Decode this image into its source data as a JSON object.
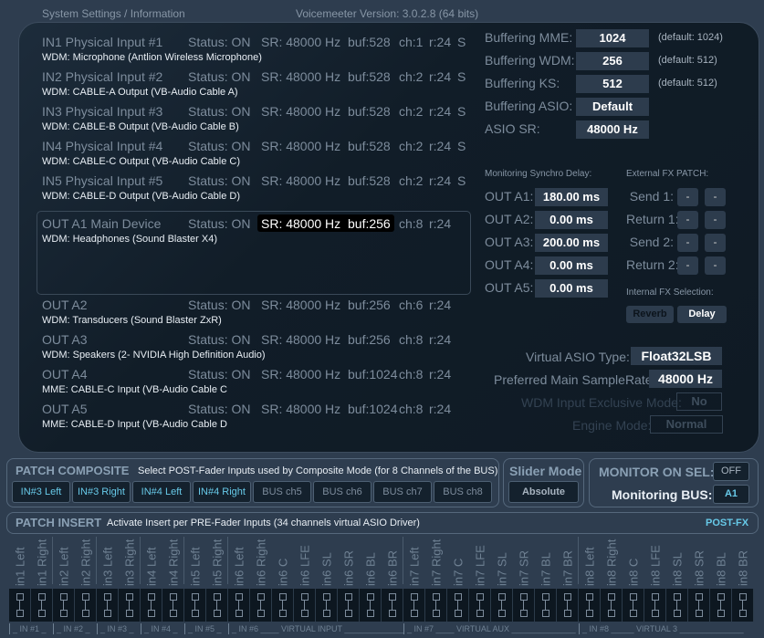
{
  "header": {
    "title": "System Settings / Information",
    "version": "Voicemeeter Version: 3.0.2.8 (64 bits)"
  },
  "devices": [
    {
      "name": "IN1 Physical Input #1",
      "status": "Status: ON",
      "sr": "SR: 48000 Hz",
      "buf": "buf:528",
      "ch": "ch:1",
      "r": "r:24",
      "s": "S",
      "driver": "WDM: Microphone (Antlion Wireless Microphone)"
    },
    {
      "name": "IN2 Physical Input #2",
      "status": "Status: ON",
      "sr": "SR: 48000 Hz",
      "buf": "buf:528",
      "ch": "ch:2",
      "r": "r:24",
      "s": "S",
      "driver": "WDM: CABLE-A Output (VB-Audio Cable A)"
    },
    {
      "name": "IN3 Physical Input #3",
      "status": "Status: ON",
      "sr": "SR: 48000 Hz",
      "buf": "buf:528",
      "ch": "ch:2",
      "r": "r:24",
      "s": "S",
      "driver": "WDM: CABLE-B Output (VB-Audio Cable B)"
    },
    {
      "name": "IN4 Physical Input #4",
      "status": "Status: ON",
      "sr": "SR: 48000 Hz",
      "buf": "buf:528",
      "ch": "ch:2",
      "r": "r:24",
      "s": "S",
      "driver": "WDM: CABLE-C Output (VB-Audio Cable C)"
    },
    {
      "name": "IN5 Physical Input #5",
      "status": "Status: ON",
      "sr": "SR: 48000 Hz",
      "buf": "buf:528",
      "ch": "ch:2",
      "r": "r:24",
      "s": "S",
      "driver": "WDM: CABLE-D Output (VB-Audio Cable D)"
    },
    {
      "name": "OUT A1 Main Device",
      "status": "Status: ON",
      "sr": "SR: 48000 Hz",
      "buf": "buf:256",
      "ch": "ch:8",
      "r": "r:24",
      "s": "",
      "driver": "WDM: Headphones (Sound Blaster X4)"
    },
    {
      "name": "OUT A2",
      "status": "Status: ON",
      "sr": "SR: 48000 Hz",
      "buf": "buf:256",
      "ch": "ch:6",
      "r": "r:24",
      "s": "",
      "driver": "WDM: Transducers (Sound Blaster ZxR)"
    },
    {
      "name": "OUT A3",
      "status": "Status: ON",
      "sr": "SR: 48000 Hz",
      "buf": "buf:256",
      "ch": "ch:8",
      "r": "r:24",
      "s": "",
      "driver": "WDM: Speakers (2- NVIDIA High Definition Audio)"
    },
    {
      "name": "OUT A4",
      "status": "Status: ON",
      "sr": "SR: 48000 Hz",
      "buf": "buf:1024",
      "ch": "ch:8",
      "r": "r:24",
      "s": "",
      "driver": "MME: CABLE-C Input (VB-Audio Cable C"
    },
    {
      "name": "OUT A5",
      "status": "Status: ON",
      "sr": "SR: 48000 Hz",
      "buf": "buf:1024",
      "ch": "ch:8",
      "r": "r:24",
      "s": "",
      "driver": "MME: CABLE-D Input (VB-Audio Cable D"
    }
  ],
  "buffering": [
    {
      "label": "Buffering MME:",
      "value": "1024",
      "default": "(default: 1024)"
    },
    {
      "label": "Buffering WDM:",
      "value": "256",
      "default": "(default: 512)"
    },
    {
      "label": "Buffering KS:",
      "value": "512",
      "default": "(default: 512)"
    },
    {
      "label": "Buffering ASIO:",
      "value": "Default",
      "default": ""
    },
    {
      "label": "ASIO SR:",
      "value": "48000 Hz",
      "default": ""
    }
  ],
  "delay": {
    "title": "Monitoring Synchro Delay:",
    "rows": [
      {
        "label": "OUT A1:",
        "value": "180.00 ms"
      },
      {
        "label": "OUT A2:",
        "value": "0.00 ms"
      },
      {
        "label": "OUT A3:",
        "value": "200.00 ms"
      },
      {
        "label": "OUT A4:",
        "value": "0.00 ms"
      },
      {
        "label": "OUT A5:",
        "value": "0.00 ms"
      }
    ]
  },
  "fx_patch": {
    "title": "External FX PATCH:",
    "rows": [
      {
        "label": "Send 1:",
        "a": "-",
        "b": "-"
      },
      {
        "label": "Return 1:",
        "a": "-",
        "b": "-"
      },
      {
        "label": "Send 2:",
        "a": "-",
        "b": "-"
      },
      {
        "label": "Return 2:",
        "a": "-",
        "b": "-"
      }
    ]
  },
  "internal_fx": {
    "title": "Internal FX Selection:",
    "reverb": "Reverb",
    "delay": "Delay"
  },
  "asio_type": {
    "label": "Virtual ASIO Type:",
    "value": "Float32LSB"
  },
  "samplerate": {
    "label": "Preferred Main SampleRate:",
    "value": "48000 Hz"
  },
  "wdm_excl": {
    "label": "WDM Input Exclusive Mode:",
    "value": "No"
  },
  "engine": {
    "label": "Engine Mode:",
    "value": "Normal"
  },
  "composite": {
    "title": "PATCH COMPOSITE",
    "desc": "Select POST-Fader Inputs used by Composite Mode (for 8 Channels of the BUS)",
    "buttons": [
      {
        "label": "IN#3 Left",
        "active": true
      },
      {
        "label": "IN#3 Right",
        "active": true
      },
      {
        "label": "IN#4 Left",
        "active": true
      },
      {
        "label": "IN#4 Right",
        "active": true
      },
      {
        "label": "BUS ch5",
        "active": false
      },
      {
        "label": "BUS ch6",
        "active": false
      },
      {
        "label": "BUS ch7",
        "active": false
      },
      {
        "label": "BUS ch8",
        "active": false
      }
    ]
  },
  "slider": {
    "title": "Slider Mode",
    "value": "Absolute"
  },
  "monitor": {
    "title": "MONITOR ON SEL:",
    "value": "OFF",
    "bus_label": "Monitoring BUS:",
    "bus": "A1"
  },
  "insert": {
    "title": "PATCH INSERT",
    "desc": "Activate Insert per PRE-Fader Inputs (34 channels virtual ASIO Driver)",
    "mode": "POST-FX",
    "channels": [
      "in1 Left",
      "in1 Right",
      "in2 Left",
      "in2 Right",
      "in3 Left",
      "in3 Right",
      "in4 Left",
      "in4 Right",
      "in5 Left",
      "in5 Right",
      "in6 Left",
      "in6 Right",
      "in6 C",
      "in6 LFE",
      "in6 SL",
      "in6 SR",
      "in6 BL",
      "in6 BR",
      "in7 Left",
      "in7 Right",
      "in7 C",
      "in7 LFE",
      "in7 SL",
      "in7 SR",
      "in7 BL",
      "in7 BR",
      "in8 Left",
      "in8 Right",
      "in8 C",
      "in8 LFE",
      "in8 SL",
      "in8 SR",
      "in8 BL",
      "in8 BR"
    ],
    "groups": [
      {
        "label": "_ IN #1 _",
        "n": 2
      },
      {
        "label": "_ IN #2 _",
        "n": 2
      },
      {
        "label": "_ IN #3 _",
        "n": 2
      },
      {
        "label": "_ IN #4 _",
        "n": 2
      },
      {
        "label": "_ IN #5 _",
        "n": 2
      },
      {
        "label": "_ IN #6 ____ VIRTUAL INPUT ______________",
        "n": 8
      },
      {
        "label": "_ IN #7 ____ VIRTUAL AUX ______________",
        "n": 8
      },
      {
        "label": "_ IN #8 _____ VIRTUAL 3 ______________",
        "n": 8
      }
    ]
  },
  "colors": {
    "accent": "#67c9e8",
    "background": "#2e3d4f",
    "panel": "#111d28"
  }
}
